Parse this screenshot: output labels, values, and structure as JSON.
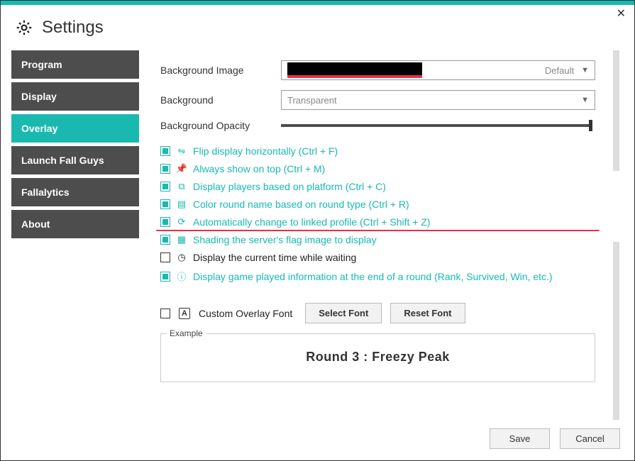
{
  "title": "Settings",
  "sidebar": {
    "items": [
      {
        "label": "Program"
      },
      {
        "label": "Display"
      },
      {
        "label": "Overlay"
      },
      {
        "label": "Launch Fall Guys"
      },
      {
        "label": "Fallalytics"
      },
      {
        "label": "About"
      }
    ],
    "active_index": 2
  },
  "form": {
    "bg_image_label": "Background Image",
    "bg_image_value": "Default",
    "bg_label": "Background",
    "bg_value": "Transparent",
    "bg_opacity_label": "Background Opacity",
    "bg_opacity_value": 100
  },
  "checks": [
    {
      "label": "Flip display horizontally (Ctrl + F)",
      "checked": true,
      "icon": "flip-icon",
      "color": "teal"
    },
    {
      "label": "Always show on top (Ctrl + M)",
      "checked": true,
      "icon": "pin-icon",
      "color": "teal"
    },
    {
      "label": "Display players based on platform (Ctrl + C)",
      "checked": true,
      "icon": "platform-icon",
      "color": "teal"
    },
    {
      "label": "Color round name based on round type (Ctrl + R)",
      "checked": true,
      "icon": "palette-icon",
      "color": "teal"
    },
    {
      "label": "Automatically change to linked profile (Ctrl + Shift + Z)",
      "checked": true,
      "icon": "link-rotate-icon",
      "color": "teal",
      "highlight": true
    },
    {
      "label": "Shading the server's flag image to display",
      "checked": true,
      "icon": "grid-icon",
      "color": "teal"
    },
    {
      "label": "Display the current time while waiting",
      "checked": false,
      "icon": "clock-icon",
      "color": "black"
    },
    {
      "label": "Display game played information at the end of a round (Rank, Survived, Win, etc.)",
      "checked": true,
      "icon": "info-icon",
      "color": "teal"
    }
  ],
  "font": {
    "custom_font_checked": true,
    "custom_font_label": "Custom Overlay Font",
    "select_btn": "Select Font",
    "reset_btn": "Reset Font"
  },
  "example": {
    "legend": "Example",
    "text": "Round 3 : Freezy Peak"
  },
  "footer": {
    "save": "Save",
    "cancel": "Cancel"
  },
  "colors": {
    "accent": "#19b9b0",
    "sidebar_bg": "#4d4d4d",
    "highlight_red": "#e8304d"
  }
}
